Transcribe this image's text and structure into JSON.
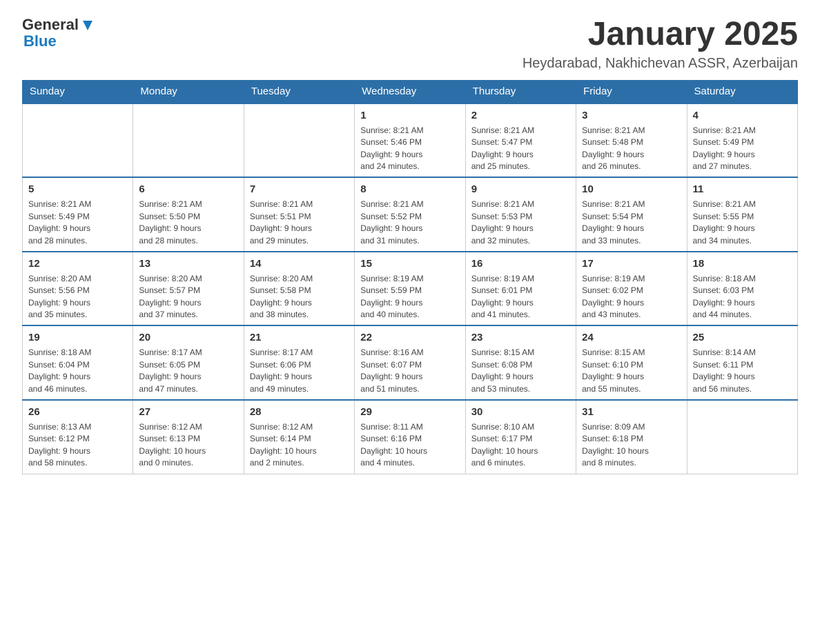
{
  "logo": {
    "general": "General",
    "blue": "Blue"
  },
  "header": {
    "month": "January 2025",
    "location": "Heydarabad, Nakhichevan ASSR, Azerbaijan"
  },
  "days_of_week": [
    "Sunday",
    "Monday",
    "Tuesday",
    "Wednesday",
    "Thursday",
    "Friday",
    "Saturday"
  ],
  "weeks": [
    [
      {
        "day": "",
        "info": ""
      },
      {
        "day": "",
        "info": ""
      },
      {
        "day": "",
        "info": ""
      },
      {
        "day": "1",
        "info": "Sunrise: 8:21 AM\nSunset: 5:46 PM\nDaylight: 9 hours\nand 24 minutes."
      },
      {
        "day": "2",
        "info": "Sunrise: 8:21 AM\nSunset: 5:47 PM\nDaylight: 9 hours\nand 25 minutes."
      },
      {
        "day": "3",
        "info": "Sunrise: 8:21 AM\nSunset: 5:48 PM\nDaylight: 9 hours\nand 26 minutes."
      },
      {
        "day": "4",
        "info": "Sunrise: 8:21 AM\nSunset: 5:49 PM\nDaylight: 9 hours\nand 27 minutes."
      }
    ],
    [
      {
        "day": "5",
        "info": "Sunrise: 8:21 AM\nSunset: 5:49 PM\nDaylight: 9 hours\nand 28 minutes."
      },
      {
        "day": "6",
        "info": "Sunrise: 8:21 AM\nSunset: 5:50 PM\nDaylight: 9 hours\nand 28 minutes."
      },
      {
        "day": "7",
        "info": "Sunrise: 8:21 AM\nSunset: 5:51 PM\nDaylight: 9 hours\nand 29 minutes."
      },
      {
        "day": "8",
        "info": "Sunrise: 8:21 AM\nSunset: 5:52 PM\nDaylight: 9 hours\nand 31 minutes."
      },
      {
        "day": "9",
        "info": "Sunrise: 8:21 AM\nSunset: 5:53 PM\nDaylight: 9 hours\nand 32 minutes."
      },
      {
        "day": "10",
        "info": "Sunrise: 8:21 AM\nSunset: 5:54 PM\nDaylight: 9 hours\nand 33 minutes."
      },
      {
        "day": "11",
        "info": "Sunrise: 8:21 AM\nSunset: 5:55 PM\nDaylight: 9 hours\nand 34 minutes."
      }
    ],
    [
      {
        "day": "12",
        "info": "Sunrise: 8:20 AM\nSunset: 5:56 PM\nDaylight: 9 hours\nand 35 minutes."
      },
      {
        "day": "13",
        "info": "Sunrise: 8:20 AM\nSunset: 5:57 PM\nDaylight: 9 hours\nand 37 minutes."
      },
      {
        "day": "14",
        "info": "Sunrise: 8:20 AM\nSunset: 5:58 PM\nDaylight: 9 hours\nand 38 minutes."
      },
      {
        "day": "15",
        "info": "Sunrise: 8:19 AM\nSunset: 5:59 PM\nDaylight: 9 hours\nand 40 minutes."
      },
      {
        "day": "16",
        "info": "Sunrise: 8:19 AM\nSunset: 6:01 PM\nDaylight: 9 hours\nand 41 minutes."
      },
      {
        "day": "17",
        "info": "Sunrise: 8:19 AM\nSunset: 6:02 PM\nDaylight: 9 hours\nand 43 minutes."
      },
      {
        "day": "18",
        "info": "Sunrise: 8:18 AM\nSunset: 6:03 PM\nDaylight: 9 hours\nand 44 minutes."
      }
    ],
    [
      {
        "day": "19",
        "info": "Sunrise: 8:18 AM\nSunset: 6:04 PM\nDaylight: 9 hours\nand 46 minutes."
      },
      {
        "day": "20",
        "info": "Sunrise: 8:17 AM\nSunset: 6:05 PM\nDaylight: 9 hours\nand 47 minutes."
      },
      {
        "day": "21",
        "info": "Sunrise: 8:17 AM\nSunset: 6:06 PM\nDaylight: 9 hours\nand 49 minutes."
      },
      {
        "day": "22",
        "info": "Sunrise: 8:16 AM\nSunset: 6:07 PM\nDaylight: 9 hours\nand 51 minutes."
      },
      {
        "day": "23",
        "info": "Sunrise: 8:15 AM\nSunset: 6:08 PM\nDaylight: 9 hours\nand 53 minutes."
      },
      {
        "day": "24",
        "info": "Sunrise: 8:15 AM\nSunset: 6:10 PM\nDaylight: 9 hours\nand 55 minutes."
      },
      {
        "day": "25",
        "info": "Sunrise: 8:14 AM\nSunset: 6:11 PM\nDaylight: 9 hours\nand 56 minutes."
      }
    ],
    [
      {
        "day": "26",
        "info": "Sunrise: 8:13 AM\nSunset: 6:12 PM\nDaylight: 9 hours\nand 58 minutes."
      },
      {
        "day": "27",
        "info": "Sunrise: 8:12 AM\nSunset: 6:13 PM\nDaylight: 10 hours\nand 0 minutes."
      },
      {
        "day": "28",
        "info": "Sunrise: 8:12 AM\nSunset: 6:14 PM\nDaylight: 10 hours\nand 2 minutes."
      },
      {
        "day": "29",
        "info": "Sunrise: 8:11 AM\nSunset: 6:16 PM\nDaylight: 10 hours\nand 4 minutes."
      },
      {
        "day": "30",
        "info": "Sunrise: 8:10 AM\nSunset: 6:17 PM\nDaylight: 10 hours\nand 6 minutes."
      },
      {
        "day": "31",
        "info": "Sunrise: 8:09 AM\nSunset: 6:18 PM\nDaylight: 10 hours\nand 8 minutes."
      },
      {
        "day": "",
        "info": ""
      }
    ]
  ]
}
